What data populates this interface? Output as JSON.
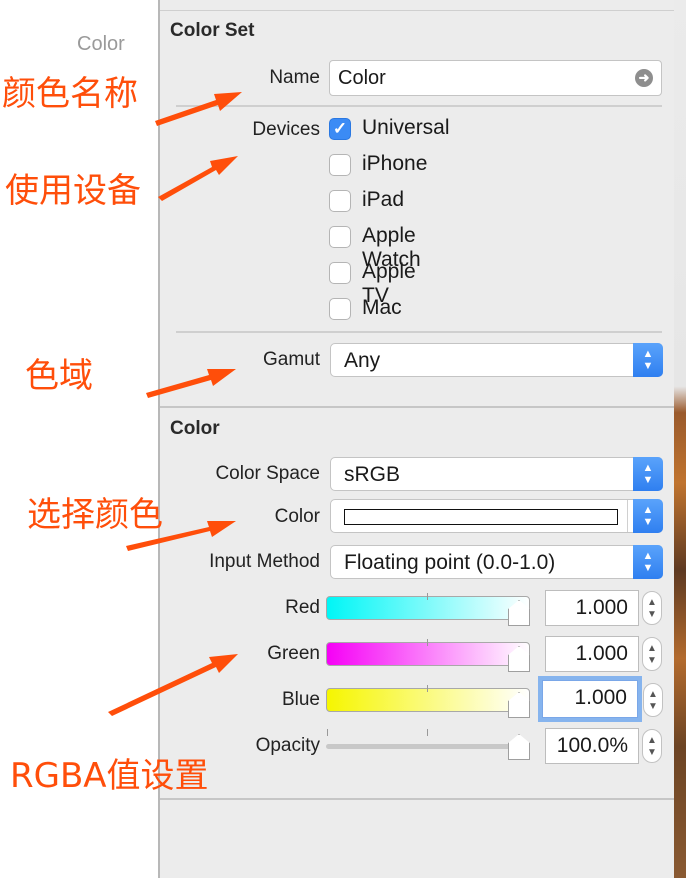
{
  "navigator": {
    "item_label": "Color"
  },
  "color_set": {
    "title": "Color Set",
    "name_label": "Name",
    "name_value": "Color",
    "devices_label": "Devices",
    "devices": [
      {
        "label": "Universal",
        "checked": true
      },
      {
        "label": "iPhone",
        "checked": false
      },
      {
        "label": "iPad",
        "checked": false
      },
      {
        "label": "Apple Watch",
        "checked": false
      },
      {
        "label": "Apple TV",
        "checked": false
      },
      {
        "label": "Mac",
        "checked": false
      }
    ],
    "gamut_label": "Gamut",
    "gamut_value": "Any"
  },
  "color": {
    "title": "Color",
    "color_space_label": "Color Space",
    "color_space_value": "sRGB",
    "color_label": "Color",
    "input_method_label": "Input Method",
    "input_method_value": "Floating point (0.0-1.0)",
    "channels": [
      {
        "label": "Red",
        "value": "1.000",
        "level": 1.0,
        "gradient_start": "#00f6f6",
        "gradient_end": "#ffffff"
      },
      {
        "label": "Green",
        "value": "1.000",
        "level": 1.0,
        "gradient_start": "#f600f6",
        "gradient_end": "#ffffff"
      },
      {
        "label": "Blue",
        "value": "1.000",
        "level": 1.0,
        "gradient_start": "#f6f600",
        "gradient_end": "#ffffff"
      }
    ],
    "opacity_label": "Opacity",
    "opacity_value": "100.0%",
    "opacity_level": 1.0
  },
  "annotations": {
    "color_name": "颜色名称",
    "devices": "使用设备",
    "gamut": "色域",
    "choose_color": "选择颜色",
    "rgba": "RGBA值设置"
  },
  "colors": {
    "annotation": "#ff4e0a",
    "checkbox_accent": "#3b8bf5",
    "popup_accent": "#2f7ff0",
    "focus_ring": "#86b4ee"
  }
}
